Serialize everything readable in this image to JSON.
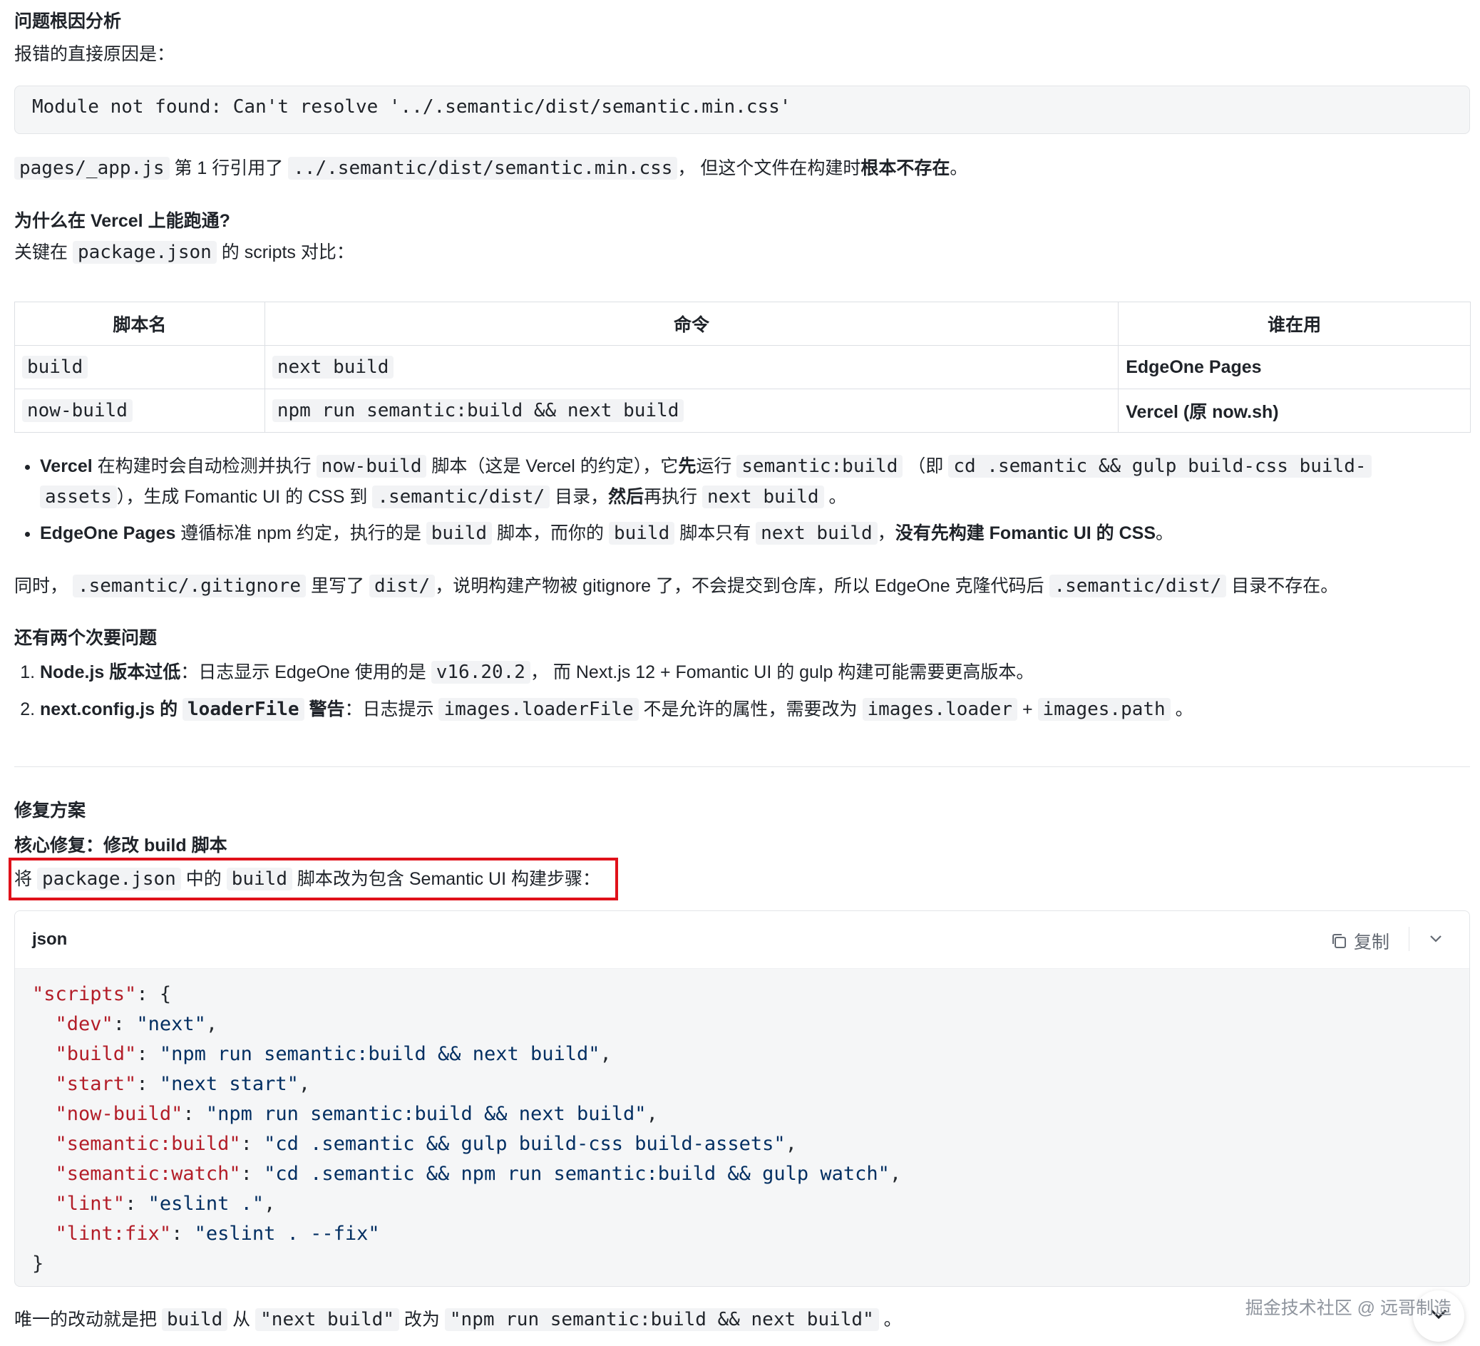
{
  "section1": {
    "title": "问题根因分析",
    "intro": "报错的直接原因是：",
    "error_code": "Module not found: Can't resolve '../.semantic/dist/semantic.min.css'",
    "line": {
      "c1": "pages/_app.js",
      "t1": " 第 1 行引用了 ",
      "c2": "../.semantic/dist/semantic.min.css",
      "t2": "， 但这个文件在构建时",
      "bold": "根本不存在",
      "t3": "。"
    }
  },
  "section2": {
    "title": "为什么在 Vercel 上能跑通?",
    "intro_t1": "关键在 ",
    "intro_code": "package.json",
    "intro_t2": " 的 scripts 对比：",
    "table": {
      "headers": [
        "脚本名",
        "命令",
        "谁在用"
      ],
      "rows": [
        {
          "name": "build",
          "cmd": "next build",
          "who": "EdgeOne Pages"
        },
        {
          "name": "now-build",
          "cmd": "npm run semantic:build && next build",
          "who": "Vercel (原 now.sh)"
        }
      ]
    },
    "bullet1": {
      "b1": "Vercel",
      "t1": " 在构建时会自动检测并执行 ",
      "c1": "now-build",
      "t2": " 脚本（这是 Vercel 的约定），它",
      "b2": "先",
      "t3": "运行 ",
      "c2": "semantic:build",
      "t4": " （即 ",
      "c3a": "cd .semantic && gulp build-css build-",
      "c3b": "assets",
      "t5": "），生成 Fomantic UI 的 CSS 到 ",
      "c4": ".semantic/dist/",
      "t6": " 目录，",
      "b3": "然后",
      "t7": "再执行 ",
      "c5": "next build",
      "t8": " 。"
    },
    "bullet2": {
      "b1": "EdgeOne Pages",
      "t1": " 遵循标准 npm 约定，执行的是 ",
      "c1": "build",
      "t2": " 脚本，而你的 ",
      "c2": "build",
      "t3": " 脚本只有 ",
      "c3": "next build",
      "t4": "，",
      "b2": "没有先构建 Fomantic UI 的 CSS",
      "t5": "。"
    },
    "also": {
      "t1": "同时， ",
      "c1": ".semantic/.gitignore",
      "t2": " 里写了 ",
      "c2": "dist/",
      "t3": "，说明构建产物被 gitignore 了，不会提交到仓库，所以 EdgeOne 克隆代码后 ",
      "c3": ".semantic/dist/",
      "t4": " 目录不存在。"
    }
  },
  "section3": {
    "title": "还有两个次要问题",
    "item1": {
      "b": "Node.js 版本过低",
      "t1": "：日志显示 EdgeOne 使用的是 ",
      "c1": "v16.20.2",
      "t2": "， 而 Next.js 12 + Fomantic UI 的 gulp 构建可能需要更高版本。"
    },
    "item2": {
      "b1": "next.config.js 的 ",
      "c0": "loaderFile",
      "b2": " 警告",
      "t1": "：日志提示 ",
      "c1": "images.loaderFile",
      "t2": " 不是允许的属性，需要改为 ",
      "c2": "images.loader",
      "t3": " + ",
      "c3": "images.path",
      "t4": " 。"
    }
  },
  "section4": {
    "title": "修复方案",
    "subtitle": "核心修复：修改 build 脚本",
    "line": {
      "t1": "将 ",
      "c1": "package.json",
      "t2": " 中的 ",
      "c2": "build",
      "t3": " 脚本改为包含 Semantic UI 构建步骤："
    },
    "code": {
      "lang": "json",
      "copy_label": "复制",
      "open": "\"scripts\"",
      "open_tail": ": {",
      "entries": [
        {
          "k": "\"dev\"",
          "v": "\"next\"",
          "comma": ","
        },
        {
          "k": "\"build\"",
          "v": "\"npm run semantic:build && next build\"",
          "comma": ","
        },
        {
          "k": "\"start\"",
          "v": "\"next start\"",
          "comma": ","
        },
        {
          "k": "\"now-build\"",
          "v": "\"npm run semantic:build && next build\"",
          "comma": ","
        },
        {
          "k": "\"semantic:build\"",
          "v": "\"cd .semantic && gulp build-css build-assets\"",
          "comma": ","
        },
        {
          "k": "\"semantic:watch\"",
          "v": "\"cd .semantic && npm run semantic:build && gulp watch\"",
          "comma": ","
        },
        {
          "k": "\"lint\"",
          "v": "\"eslint .\"",
          "comma": ","
        },
        {
          "k": "\"lint:fix\"",
          "v": "\"eslint . --fix\"",
          "comma": ""
        }
      ],
      "close": "}"
    },
    "last": {
      "t1": "唯一的改动就是把 ",
      "c1": "build",
      "t2": " 从 ",
      "c2": "\"next build\"",
      "t3": " 改为 ",
      "c3": "\"npm run semantic:build && next build\"",
      "t4": " 。"
    }
  },
  "watermark": "掘金技术社区 @ 远哥制造",
  "colors": {
    "highlight_border": "#e0111a",
    "json_key": "#b31d28",
    "json_string": "#032f62"
  }
}
